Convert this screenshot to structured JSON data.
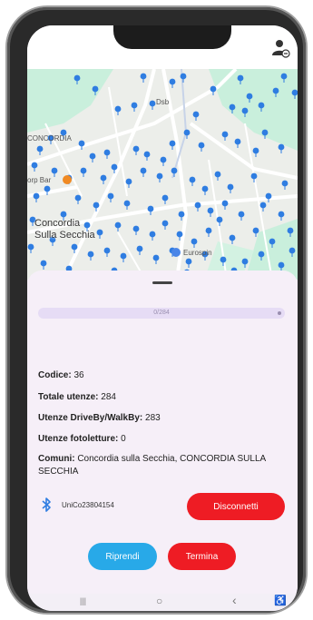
{
  "map": {
    "labels": {
      "dsb": "Dsb",
      "concordia_top": "CONCORDIA",
      "bar": "orp Bar",
      "town_line1": "Concordia",
      "town_line2": "Sulla Secchia",
      "eurospin": "Eurospin"
    },
    "colors": {
      "pin": "#2f7de1",
      "park": "#c9efdc",
      "road": "#ffffff"
    }
  },
  "progress": {
    "text": "0/284",
    "fraction": 0.0
  },
  "info": {
    "codice_label": "Codice:",
    "codice_value": "36",
    "totale_label": "Totale utenze:",
    "totale_value": "284",
    "driveby_label": "Utenze DriveBy/WalkBy:",
    "driveby_value": "283",
    "foto_label": "Utenze fotoletture:",
    "foto_value": "0",
    "comuni_label": "Comuni:",
    "comuni_value": "Concordia sulla Secchia, CONCORDIA SULLA SECCHIA"
  },
  "bluetooth": {
    "icon": "bluetooth-icon",
    "device": "UniCo23804154"
  },
  "buttons": {
    "disconnect": "Disconnetti",
    "resume": "Riprendi",
    "stop": "Termina"
  },
  "navbar": {
    "recents": "|||",
    "home": "○",
    "back": "‹",
    "accessibility": "♿"
  },
  "colors": {
    "accent_red": "#ee1c24",
    "accent_blue": "#28a9e8",
    "sheet_bg": "#f6eff8"
  }
}
